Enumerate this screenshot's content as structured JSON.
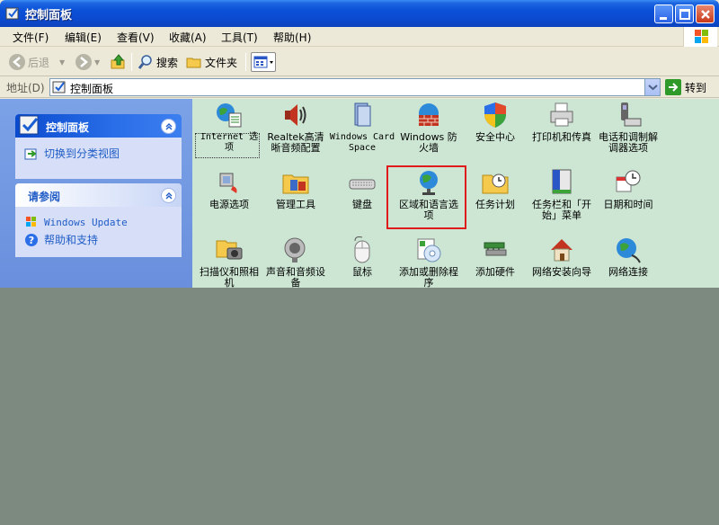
{
  "window": {
    "title": "控制面板"
  },
  "menu": [
    "文件(F)",
    "编辑(E)",
    "查看(V)",
    "收藏(A)",
    "工具(T)",
    "帮助(H)"
  ],
  "toolbar": {
    "back": "后退",
    "search": "搜索",
    "folders": "文件夹"
  },
  "address": {
    "label": "地址(D)",
    "value": "控制面板",
    "go": "转到"
  },
  "sidepanel": {
    "control_panel": {
      "title": "控制面板",
      "link": "切换到分类视图"
    },
    "see_also": {
      "title": "请参阅",
      "links": [
        "Windows Update",
        "帮助和支持"
      ]
    }
  },
  "items": [
    "Internet 选项",
    "Realtek高清晰音频配置",
    "Windows CardSpace",
    "Windows 防火墙",
    "安全中心",
    "打印机和传真",
    "电话和调制解调器选项",
    "电源选项",
    "管理工具",
    "键盘",
    "区域和语言选项",
    "任务计划",
    "任务栏和「开始」菜单",
    "日期和时间",
    "扫描仪和照相机",
    "声音和音频设备",
    "鼠标",
    "添加或删除程序",
    "添加硬件",
    "网络安装向导",
    "网络连接"
  ],
  "colors": {
    "highlight": "#e01b1b",
    "content_bg": "#cde6d3",
    "below_window": "#7c8a7f"
  }
}
